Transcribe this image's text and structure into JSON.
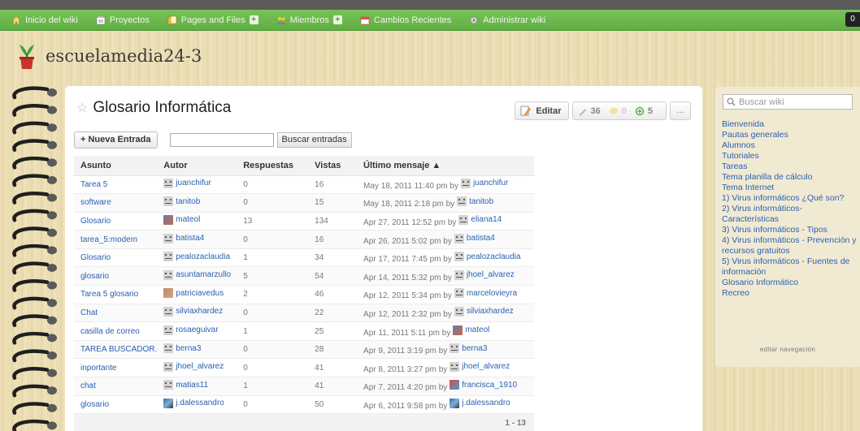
{
  "nav": {
    "items": [
      {
        "label": "Inicio del wiki",
        "icon": "home-icon",
        "has_plus": false
      },
      {
        "label": "Proyectos",
        "icon": "projects-icon",
        "has_plus": false
      },
      {
        "label": "Pages and Files",
        "icon": "pages-icon",
        "has_plus": true
      },
      {
        "label": "Miembros",
        "icon": "members-icon",
        "has_plus": true
      },
      {
        "label": "Cambios Recientes",
        "icon": "calendar-icon",
        "has_plus": false
      },
      {
        "label": "Administrar wiki",
        "icon": "gear-icon",
        "has_plus": false
      }
    ],
    "counter": "0"
  },
  "wiki": {
    "name": "escuelamedia24-3"
  },
  "page": {
    "title": "Glosario Informática",
    "edit_label": "Editar",
    "stats": {
      "revisions": "36",
      "comments": "0",
      "followers": "5"
    },
    "more_label": "..."
  },
  "toolbar": {
    "new_entry_label": "+ Nueva Entrada",
    "search_value": "",
    "search_button_label": "Buscar entradas"
  },
  "table": {
    "headers": [
      "Asunto",
      "Autor",
      "Respuestas",
      "Vistas",
      "Último mensaje ▲"
    ],
    "by_label": "by",
    "rows": [
      {
        "subject": "Tarea 5",
        "author": "juanchifur",
        "author_avatar": "default",
        "replies": "0",
        "views": "16",
        "last_date": "May 18, 2011 11:40 pm",
        "last_user": "juanchifur",
        "last_avatar": "default"
      },
      {
        "subject": "software",
        "author": "tanitob",
        "author_avatar": "default",
        "replies": "0",
        "views": "15",
        "last_date": "May 18, 2011 2:18 pm",
        "last_user": "tanitob",
        "last_avatar": "default"
      },
      {
        "subject": "Glosario",
        "author": "mateol",
        "author_avatar": "photo1",
        "replies": "13",
        "views": "134",
        "last_date": "Apr 27, 2011 12:52 pm",
        "last_user": "eliana14",
        "last_avatar": "default"
      },
      {
        "subject": "tarea_5:modem",
        "author": "batista4",
        "author_avatar": "default",
        "replies": "0",
        "views": "16",
        "last_date": "Apr 26, 2011 5:02 pm",
        "last_user": "batista4",
        "last_avatar": "default"
      },
      {
        "subject": "Glosario",
        "author": "pealozaclaudia",
        "author_avatar": "default",
        "replies": "1",
        "views": "34",
        "last_date": "Apr 17, 2011 7:45 pm",
        "last_user": "pealozaclaudia",
        "last_avatar": "default"
      },
      {
        "subject": "glosario",
        "author": "asuntamarzullo",
        "author_avatar": "default",
        "replies": "5",
        "views": "54",
        "last_date": "Apr 14, 2011 5:32 pm",
        "last_user": "jhoel_alvarez",
        "last_avatar": "default"
      },
      {
        "subject": "Tarea 5 glosario",
        "author": "patriciavedus",
        "author_avatar": "photo2",
        "replies": "2",
        "views": "46",
        "last_date": "Apr 12, 2011 5:34 pm",
        "last_user": "marcelovieyra",
        "last_avatar": "default"
      },
      {
        "subject": "Chat",
        "author": "silviaxhardez",
        "author_avatar": "default",
        "replies": "0",
        "views": "22",
        "last_date": "Apr 12, 2011 2:32 pm",
        "last_user": "silviaxhardez",
        "last_avatar": "default"
      },
      {
        "subject": "casilla de correo",
        "author": "rosaeguivar",
        "author_avatar": "default",
        "replies": "1",
        "views": "25",
        "last_date": "Apr 11, 2011 5:11 pm",
        "last_user": "mateol",
        "last_avatar": "photo1"
      },
      {
        "subject": "TAREA BUSCADOR.",
        "author": "berna3",
        "author_avatar": "default",
        "replies": "0",
        "views": "28",
        "last_date": "Apr 9, 2011 3:19 pm",
        "last_user": "berna3",
        "last_avatar": "default"
      },
      {
        "subject": "inportante",
        "author": "jhoel_alvarez",
        "author_avatar": "default",
        "replies": "0",
        "views": "41",
        "last_date": "Apr 8, 2011 3:27 pm",
        "last_user": "jhoel_alvarez",
        "last_avatar": "default"
      },
      {
        "subject": "chat",
        "author": "matias11",
        "author_avatar": "default",
        "replies": "1",
        "views": "41",
        "last_date": "Apr 7, 2011 4:20 pm",
        "last_user": "francisca_1910",
        "last_avatar": "photo4"
      },
      {
        "subject": "glosario",
        "author": "j.dalessandro",
        "author_avatar": "photo3",
        "replies": "0",
        "views": "50",
        "last_date": "Apr 6, 2011 9:58 pm",
        "last_user": "j.dalessandro",
        "last_avatar": "photo3"
      }
    ],
    "pagination": "1 - 13"
  },
  "sidebar": {
    "search_placeholder": "Buscar wiki",
    "items": [
      "Bienvenida",
      "Pautas generales",
      "Alumnos",
      "Tutoriales",
      "Tareas",
      "Tema planilla de cálculo",
      "Tema Internet",
      "1) Virus informáticos ¿Qué son?",
      "2) Virus informáticos-Características",
      "3) Virus informáticos - Tipos",
      "4) Virus informáticos - Prevención y recursos gratuitos",
      "5) Virus informáticos - Fuentes de información",
      "Glosario Informático",
      "Recreo"
    ],
    "edit_nav_label": "editar navegación"
  },
  "colors": {
    "nav_green": "#67b548",
    "link_blue": "#2a5fb0",
    "wood": "#e9dcb4"
  }
}
